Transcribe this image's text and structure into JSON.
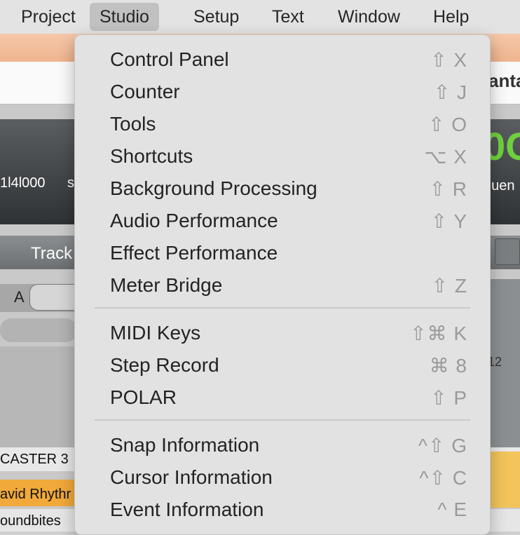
{
  "menubar": {
    "items": [
      {
        "label": "Project"
      },
      {
        "label": "Studio"
      },
      {
        "label": "Setup"
      },
      {
        "label": "Text"
      },
      {
        "label": "Window"
      },
      {
        "label": "Help"
      }
    ],
    "active": "Studio"
  },
  "background": {
    "title_fragment": "anta",
    "counter_fragment": "1l4l000",
    "s_fragment": "s",
    "green_fragment": "0C",
    "freq_fragment": "quen",
    "track_label": "Track",
    "a_label": "A",
    "ruler_number": "12",
    "row1": "CASTER 3",
    "row2": "avid Rhythr",
    "row3": "oundbites"
  },
  "studio_menu": {
    "group1": [
      {
        "label": "Control Panel",
        "shortcut": "⇧ X"
      },
      {
        "label": "Counter",
        "shortcut": "⇧ J"
      },
      {
        "label": "Tools",
        "shortcut": "⇧ O"
      },
      {
        "label": "Shortcuts",
        "shortcut": "⌥ X"
      },
      {
        "label": "Background Processing",
        "shortcut": "⇧ R"
      },
      {
        "label": "Audio Performance",
        "shortcut": "⇧ Y"
      },
      {
        "label": "Effect Performance",
        "shortcut": ""
      },
      {
        "label": "Meter Bridge",
        "shortcut": "⇧ Z"
      }
    ],
    "group2": [
      {
        "label": "MIDI Keys",
        "shortcut": "⇧⌘ K"
      },
      {
        "label": "Step Record",
        "shortcut": "⌘ 8"
      },
      {
        "label": "POLAR",
        "shortcut": "⇧ P"
      }
    ],
    "group3": [
      {
        "label": "Snap Information",
        "shortcut": "^⇧ G"
      },
      {
        "label": "Cursor Information",
        "shortcut": "^⇧ C"
      },
      {
        "label": "Event Information",
        "shortcut": "^ E"
      }
    ]
  }
}
